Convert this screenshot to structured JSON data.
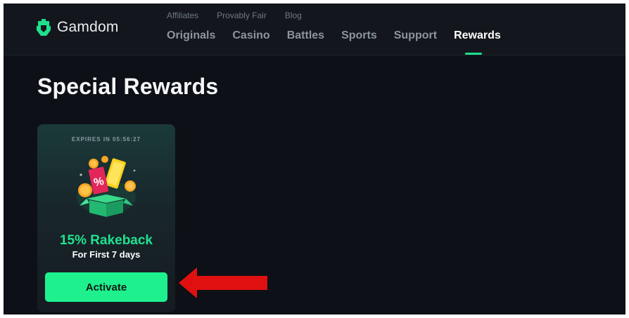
{
  "header": {
    "brand": "Gamdom",
    "brand_icon": "gamdom-logo-icon",
    "subnav": [
      "Affiliates",
      "Provably Fair",
      "Blog"
    ],
    "nav": [
      "Originals",
      "Casino",
      "Battles",
      "Sports",
      "Support",
      "Rewards"
    ],
    "active_nav": "Rewards",
    "accent_color": "#19e08a"
  },
  "page": {
    "title": "Special Rewards"
  },
  "reward_card": {
    "expires_label": "EXPIRES IN 05:56:27",
    "title": "15% Rakeback",
    "subtitle": "For First 7 days",
    "button_label": "Activate",
    "illustration_icon": "gift-box-icon",
    "button_color": "#1ff08e"
  },
  "annotation": {
    "arrow_icon": "red-arrow-icon",
    "arrow_color": "#e01010"
  }
}
